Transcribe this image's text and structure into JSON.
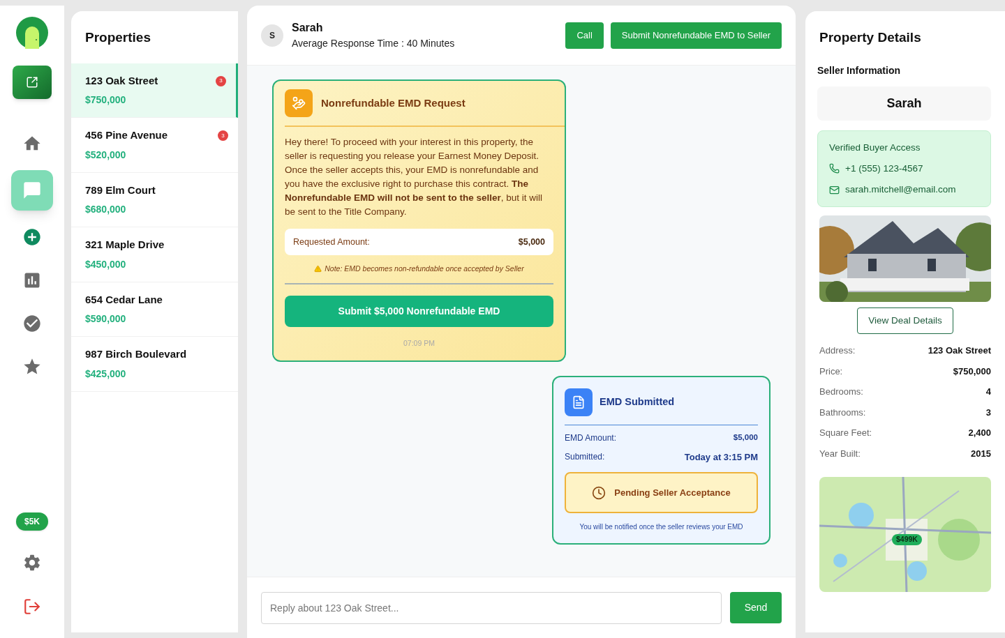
{
  "rail": {
    "nav": [
      {
        "selected": false
      },
      {
        "selected": true
      },
      {
        "selected": false
      },
      {
        "selected": false
      },
      {
        "selected": false
      },
      {
        "selected": false
      }
    ],
    "badge": "$5K"
  },
  "properties": {
    "title": "Properties",
    "items": [
      {
        "name": "123 Oak Street",
        "price": "$750,000",
        "count": "3",
        "selected": true
      },
      {
        "name": "456 Pine Avenue",
        "price": "$520,000",
        "count": "3",
        "selected": false
      },
      {
        "name": "789 Elm Court",
        "price": "$680,000",
        "selected": false
      },
      {
        "name": "321 Maple Drive",
        "price": "$450,000",
        "selected": false
      },
      {
        "name": "654 Cedar Lane",
        "price": "$590,000",
        "selected": false
      },
      {
        "name": "987 Birch Boulevard",
        "price": "$425,000",
        "selected": false
      }
    ]
  },
  "chat": {
    "avatar": "S",
    "name": "Sarah",
    "subtitle": "Average Response Time : 40 Minutes",
    "buttons": [
      "Call",
      "Submit Nonrefundable EMD to Seller"
    ],
    "request": {
      "title": "Nonrefundable EMD Request",
      "body": "Hey there! To proceed with your interest in this property, the seller is requesting you release your Earnest Money Deposit. Once the seller accepts this, your EMD is nonrefundable and you have the exclusive right to purchase this contract. **The Nonrefundable EMD will not be sent to the seller**, but it will be sent to the Title Company.",
      "amount_label": "Requested Amount:",
      "amount": "$5,000",
      "note": "Note: EMD becomes non-refundable once accepted by Seller",
      "button": "Submit $5,000 Nonrefundable EMD",
      "time": "07:09 PM"
    },
    "submitted": {
      "title": "EMD Submitted",
      "rows": [
        {
          "label": "EMD Amount:",
          "value": "$5,000"
        },
        {
          "label": "Submitted:",
          "value": "Today at 3:15 PM"
        }
      ],
      "status": "Pending Seller Acceptance",
      "footnote": "You will be notified once the seller reviews your EMD"
    },
    "input": {
      "placeholder": "Reply about 123 Oak Street..."
    },
    "send": "Send"
  },
  "details": {
    "title": "Property Details",
    "seller_heading": "Seller Information",
    "seller_name": "Sarah",
    "access": {
      "title": "Verified Buyer Access",
      "phone": "+1 (555) 123-4567",
      "email": "sarah.mitchell@email.com"
    },
    "button": "View Deal Details",
    "facts": [
      {
        "label": "Address:",
        "value": "123 Oak Street"
      },
      {
        "label": "Price:",
        "value": "$750,000"
      },
      {
        "label": "Bedrooms:",
        "value": "4"
      },
      {
        "label": "Bathrooms:",
        "value": "3"
      },
      {
        "label": "Square Feet:",
        "value": "2,400"
      },
      {
        "label": "Year Built:",
        "value": "2015"
      }
    ],
    "map": {
      "kind": "picture",
      "marker": "$499K"
    }
  }
}
